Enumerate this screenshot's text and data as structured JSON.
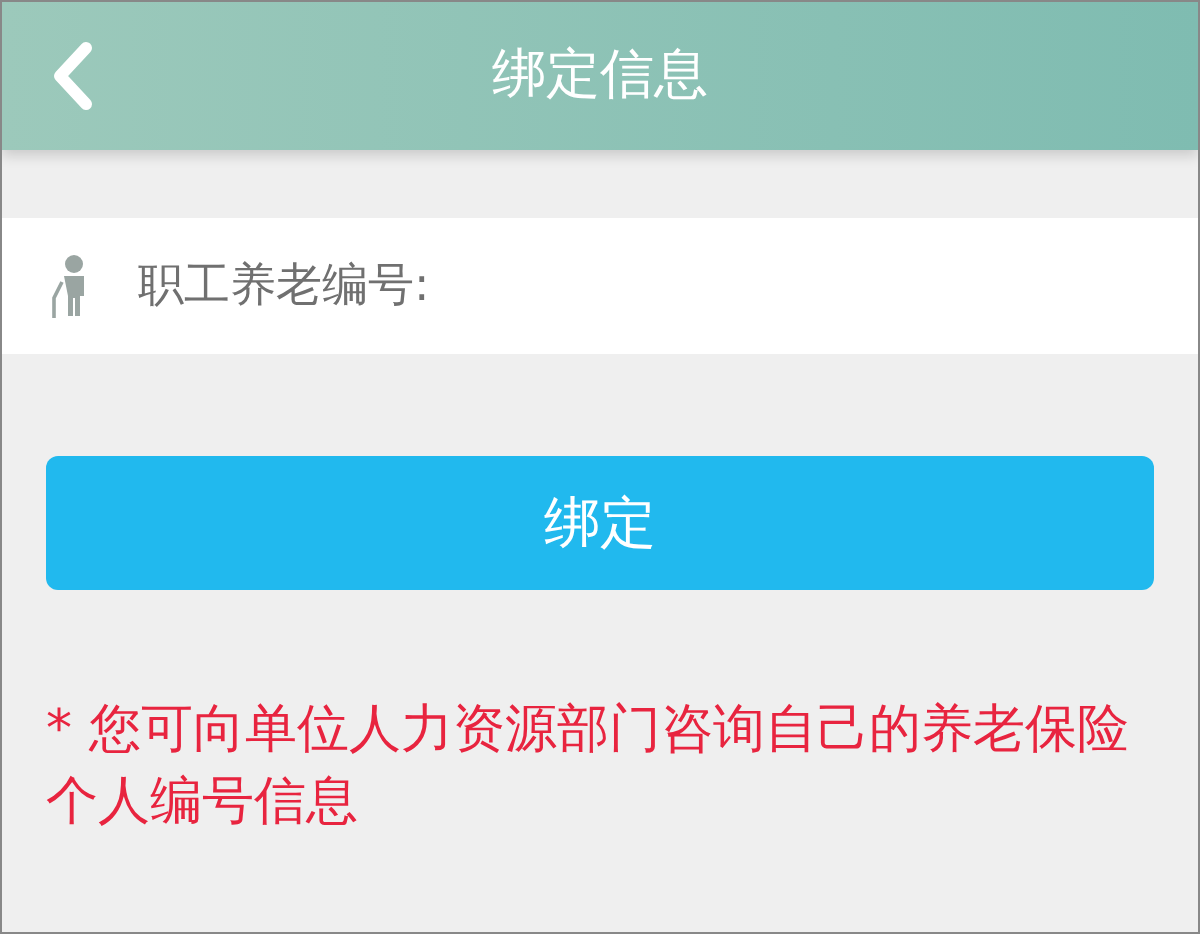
{
  "header": {
    "title": "绑定信息"
  },
  "form": {
    "label": "职工养老编号:"
  },
  "bind_button": "绑定",
  "note": "* 您可向单位人力资源部门咨询自己的养老保险个人编号信息"
}
